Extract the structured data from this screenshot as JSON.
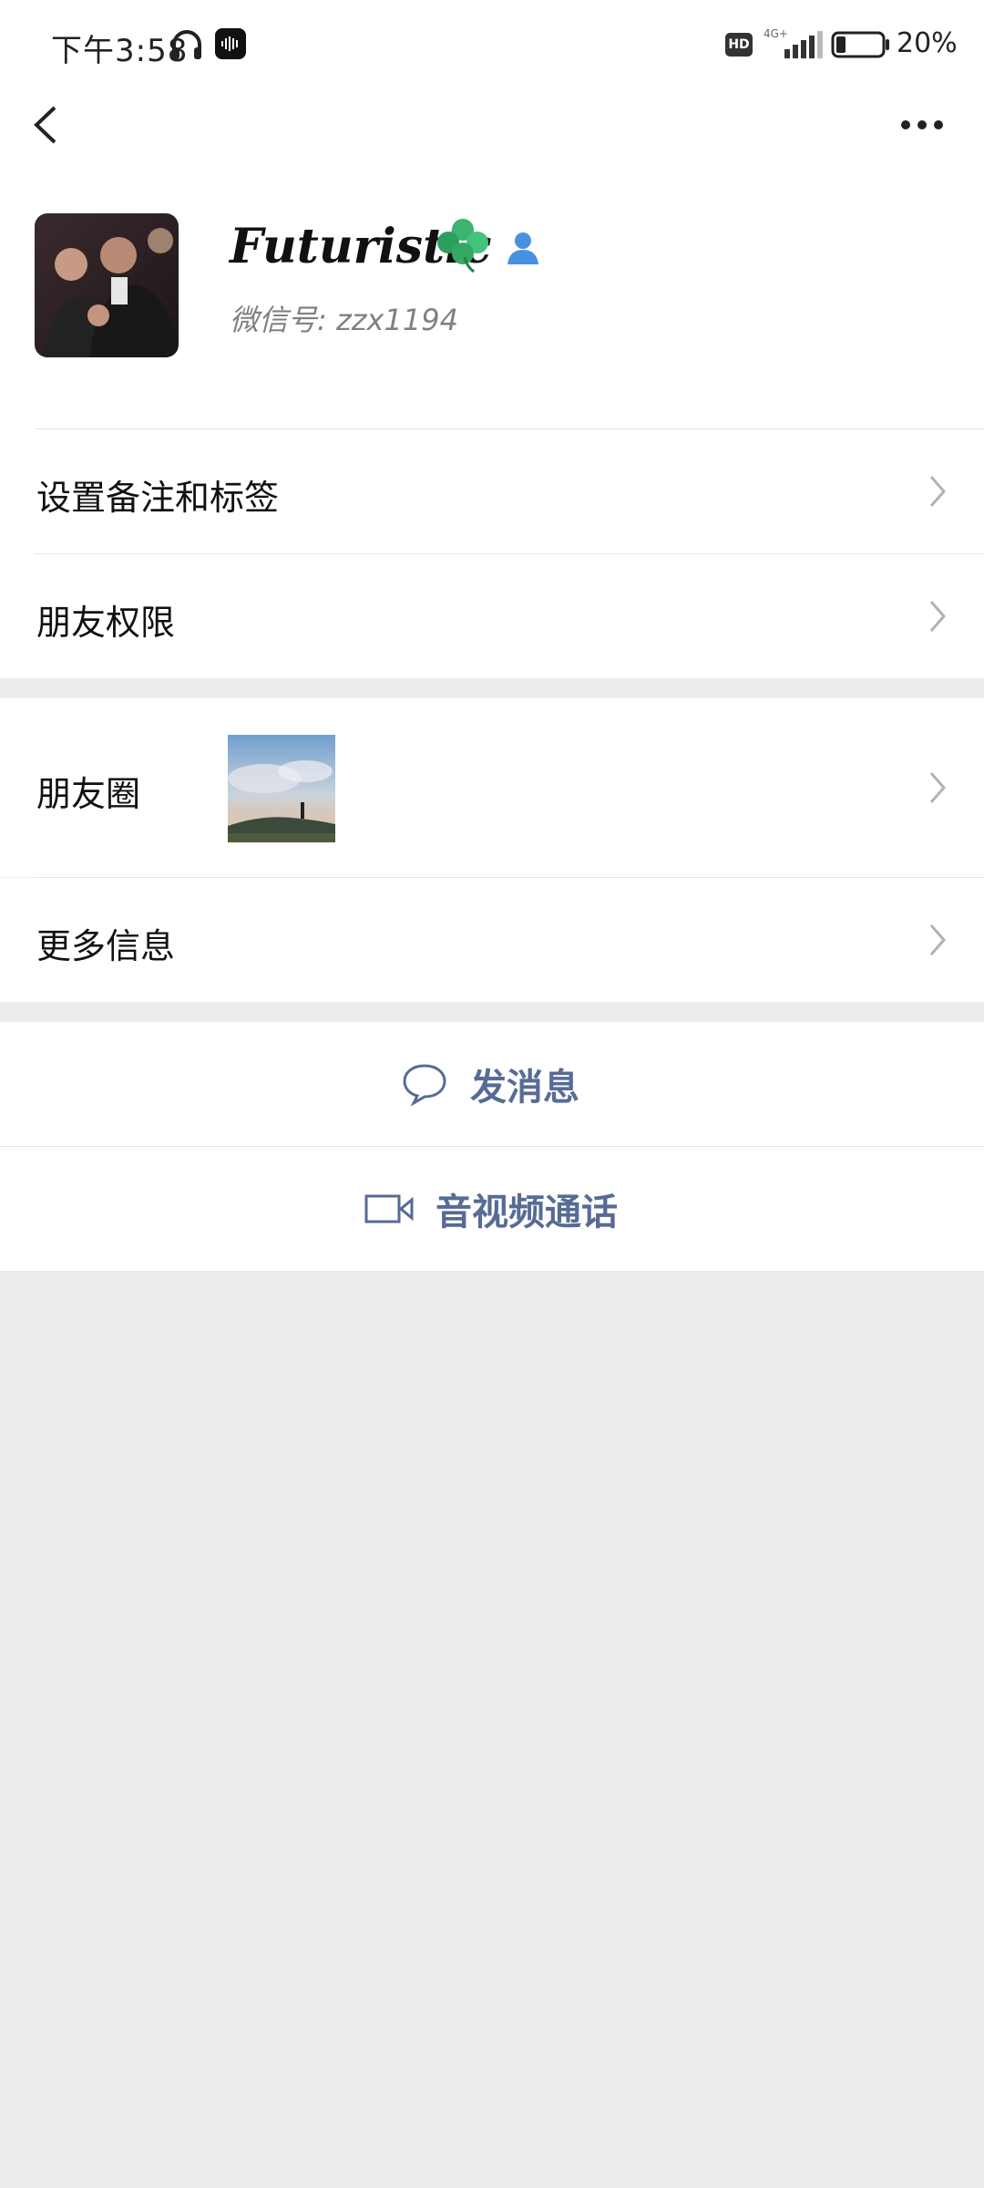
{
  "status_bar": {
    "time": "下午3:58",
    "network_type": "4G+",
    "hd_badge": "HD",
    "battery_percent": "20%",
    "battery_level": 0.2,
    "icons": [
      "headphones-icon",
      "voice-app-icon",
      "signal-icon",
      "battery-icon"
    ]
  },
  "nav": {
    "back_icon": "chevron-left-icon",
    "more_icon": "more-dots-icon"
  },
  "profile": {
    "nickname": "Futuristic",
    "nickname_emoji": "clover-icon",
    "contact_type_icon": "person-icon",
    "wechat_id": "微信号: zzx1194"
  },
  "menu": {
    "remark_tags": "设置备注和标签",
    "friend_permissions": "朋友权限",
    "moments": "朋友圈",
    "more_info": "更多信息"
  },
  "actions": {
    "send_message": "发消息",
    "video_call": "音视频通话"
  },
  "colors": {
    "background": "#ededed",
    "card": "#ffffff",
    "link_blue": "#576b95",
    "contact_icon_blue": "#4a90e2",
    "clover_green": "#3cb371"
  }
}
